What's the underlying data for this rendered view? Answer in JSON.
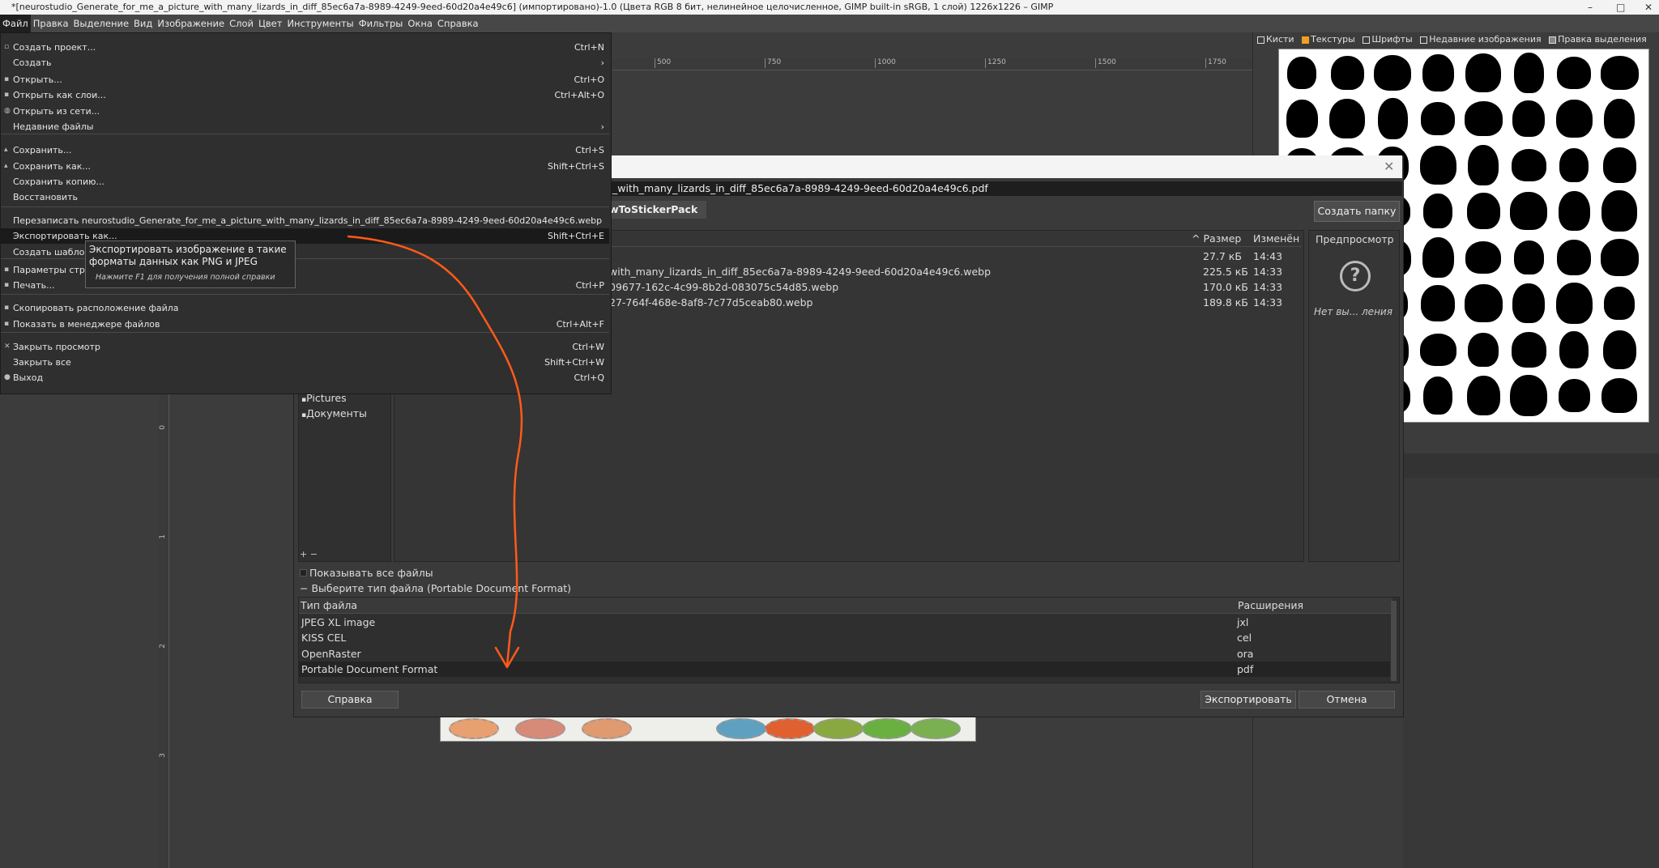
{
  "window": {
    "title": "*[neurostudio_Generate_for_me_a_picture_with_many_lizards_in_diff_85ec6a7a-8989-4249-9eed-60d20a4e49c6] (импортировано)-1.0 (Цвета RGB 8 бит, нелинейное целочисленное, GIMP built-in sRGB, 1 слой) 1226x1226 – GIMP",
    "minimize": "–",
    "maximize": "□",
    "close": "✕"
  },
  "menubar": [
    "Файл",
    "Правка",
    "Выделение",
    "Вид",
    "Изображение",
    "Слой",
    "Цвет",
    "Инструменты",
    "Фильтры",
    "Окна",
    "Справка"
  ],
  "ruler_top": [
    "500",
    "750",
    "1000",
    "1250",
    "1500",
    "1750"
  ],
  "ruler_left": [
    "0",
    "1",
    "2",
    "3"
  ],
  "dock": {
    "tabs": [
      "Кисти",
      "Текстуры",
      "Шрифты",
      "Недавние изображения",
      "Правка выделения"
    ],
    "tab_colors": [
      "#ffffff",
      "#f0a020",
      "#dddddd",
      "#dddddd",
      "#888888"
    ]
  },
  "file_menu": {
    "items": [
      {
        "icon": "▫",
        "label": "Создать проект...",
        "shortcut": "Ctrl+N"
      },
      {
        "icon": "",
        "label": "Создать",
        "shortcut": "›"
      },
      {
        "icon": "▪",
        "label": "Открыть...",
        "shortcut": "Ctrl+O"
      },
      {
        "icon": "▪",
        "label": "Открыть как слои...",
        "shortcut": "Ctrl+Alt+O"
      },
      {
        "icon": "◍",
        "label": "Открыть из сети...",
        "shortcut": ""
      },
      {
        "icon": "",
        "label": "Недавние файлы",
        "shortcut": "›"
      },
      {
        "icon": "▴",
        "label": "Сохранить...",
        "shortcut": "Ctrl+S"
      },
      {
        "icon": "▴",
        "label": "Сохранить как...",
        "shortcut": "Shift+Ctrl+S"
      },
      {
        "icon": "",
        "label": "Сохранить копию...",
        "shortcut": ""
      },
      {
        "icon": "",
        "label": "Восстановить",
        "shortcut": ""
      },
      {
        "icon": "",
        "label": "Перезаписать neurostudio_Generate_for_me_a_picture_with_many_lizards_in_diff_85ec6a7a-8989-4249-9eed-60d20a4e49c6.webp",
        "shortcut": ""
      },
      {
        "icon": "",
        "label": "Экспортировать как...",
        "shortcut": "Shift+Ctrl+E"
      },
      {
        "icon": "",
        "label": "Создать шаблон...",
        "shortcut": ""
      },
      {
        "icon": "▪",
        "label": "Параметры страни",
        "shortcut": ""
      },
      {
        "icon": "▪",
        "label": "Печать...",
        "shortcut": "Ctrl+P"
      },
      {
        "icon": "▪",
        "label": "Скопировать расположение файла",
        "shortcut": ""
      },
      {
        "icon": "▪",
        "label": "Показать в менеджере файлов",
        "shortcut": "Ctrl+Alt+F"
      },
      {
        "icon": "✕",
        "label": "Закрыть просмотр",
        "shortcut": "Ctrl+W"
      },
      {
        "icon": "",
        "label": "Закрыть все",
        "shortcut": "Shift+Ctrl+W"
      },
      {
        "icon": "●",
        "label": "Выход",
        "shortcut": "Ctrl+Q"
      }
    ]
  },
  "tooltip": {
    "line1": "Экспортировать изображение в такие",
    "line2": "форматы данных как PNG и JPEG",
    "hint": "Нажмите F1 для получения полной справки"
  },
  "dialog": {
    "filename": "_with_many_lizards_in_diff_85ec6a7a-8989-4249-9eed-60d20a4e49c6.pdf",
    "path_button": "wToStickerPack",
    "create_folder": "Создать папку",
    "places": [
      "Pictures",
      "Документы"
    ],
    "places_footer": "+ −",
    "columns": {
      "size": "Размер",
      "modified": "Изменён"
    },
    "files": [
      {
        "name": "",
        "size": "27.7 кБ",
        "time": "14:43"
      },
      {
        "name": "with_many_lizards_in_diff_85ec6a7a-8989-4249-9eed-60d20a4e49c6.webp",
        "size": "225.5 кБ",
        "time": "14:33"
      },
      {
        "name": "09677-162c-4c99-8b2d-083075c54d85.webp",
        "size": "170.0 кБ",
        "time": "14:33"
      },
      {
        "name": "27-764f-468e-8af8-7c77d5ceab80.webp",
        "size": "189.8 кБ",
        "time": "14:33"
      }
    ],
    "preview_label": "Предпросмотр",
    "preview_none": "Нет вы... ления",
    "show_all": "Показывать все файлы",
    "filetype_expander": "Выберите тип файла (Portable Document Format)",
    "types_head": {
      "name": "Тип файла",
      "ext": "Расширения"
    },
    "types": [
      {
        "name": "JPEG XL image",
        "ext": "jxl"
      },
      {
        "name": "KISS CEL",
        "ext": "cel"
      },
      {
        "name": "OpenRaster",
        "ext": "ora"
      },
      {
        "name": "Portable Document Format",
        "ext": "pdf"
      }
    ],
    "help_button": "Справка",
    "export_button": "Экспортировать",
    "cancel_button": "Отмена"
  },
  "colors": {
    "annotation_arrow": "#ff5a1a",
    "canvas_bg": "#3c3c3c",
    "menu_bg": "#2f2f2f"
  }
}
